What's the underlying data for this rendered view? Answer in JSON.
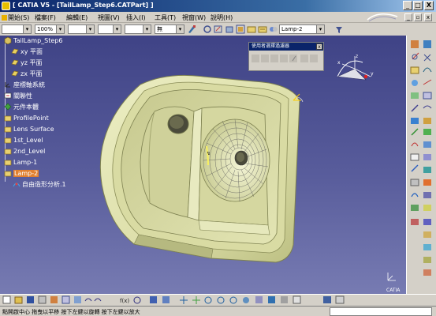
{
  "window": {
    "title": "[ CATIA V5 - [TailLamp_Step6.CATPart] ]",
    "minimize": "_",
    "maximize": "□",
    "close": "X"
  },
  "menu": {
    "items": [
      {
        "label": "開始(S)",
        "name": "menu-start"
      },
      {
        "label": "檔案(F)",
        "name": "menu-file"
      },
      {
        "label": "編輯(E)",
        "name": "menu-edit"
      },
      {
        "label": "視圖(V)",
        "name": "menu-view"
      },
      {
        "label": "插入(I)",
        "name": "menu-insert"
      },
      {
        "label": "工具(T)",
        "name": "menu-tools"
      },
      {
        "label": "視窗(W)",
        "name": "menu-window"
      },
      {
        "label": "說明(H)",
        "name": "menu-help"
      }
    ]
  },
  "format_toolbar": {
    "transparency": "100%",
    "line_none": "無",
    "layer": "Lamp-2"
  },
  "spec_tree": {
    "root": "TailLamp_Step6",
    "items": [
      {
        "label": "xy 平面",
        "icon": "plane-icon"
      },
      {
        "label": "yz 平面",
        "icon": "plane-icon"
      },
      {
        "label": "zx 平面",
        "icon": "plane-icon"
      },
      {
        "label": "座標軸系統",
        "icon": "axis-system-icon"
      },
      {
        "label": "關聯性",
        "icon": "relations-icon"
      },
      {
        "label": "元件本體",
        "icon": "part-body-icon"
      },
      {
        "label": "ProfilePoint",
        "icon": "geometrical-set-icon"
      },
      {
        "label": "Lens Surface",
        "icon": "geometrical-set-icon"
      },
      {
        "label": "1st_Level",
        "icon": "geometrical-set-icon"
      },
      {
        "label": "2nd_Level",
        "icon": "geometrical-set-icon"
      },
      {
        "label": "Lamp-1",
        "icon": "geometrical-set-icon"
      },
      {
        "label": "Lamp-2",
        "icon": "geometrical-set-icon"
      },
      {
        "label": "自由造形分析.1",
        "icon": "freestyle-analysis-icon"
      }
    ]
  },
  "filter_dialog": {
    "title": "使用者選擇過濾器",
    "close": "x"
  },
  "compass": {
    "x": "x",
    "y": "y",
    "z": "z"
  },
  "viewport": {
    "brand": "CATIA"
  },
  "status": {
    "hint": "點開啟中心  拖曳以平移  按下左鍵以旋轉  按下左鍵以放大"
  },
  "colors": {
    "part": "#e2e4b0",
    "part_shadow": "#b3b67c",
    "selected": "#e08030",
    "viewport_top": "#3f4386",
    "viewport_bottom": "#777bb2"
  }
}
